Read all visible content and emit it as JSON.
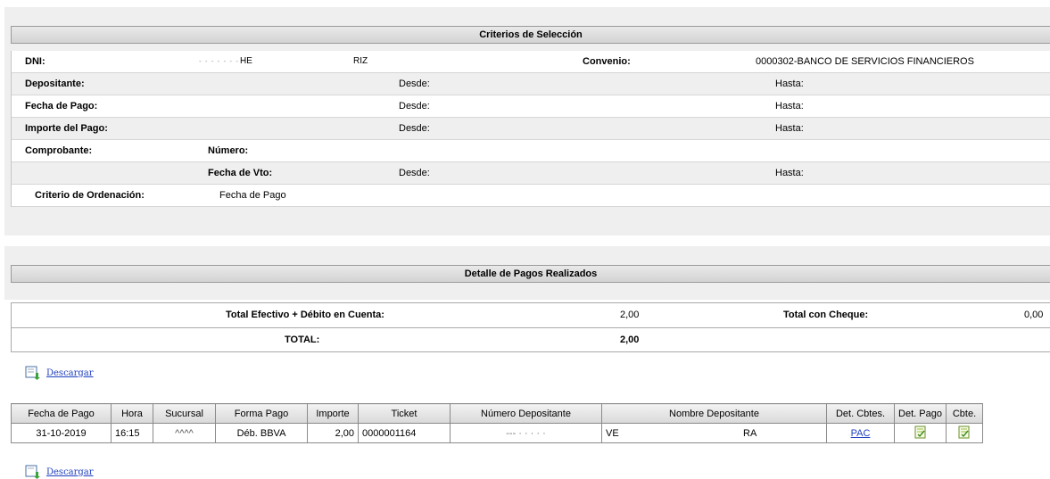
{
  "criteria": {
    "title": "Criterios de Selección",
    "dni_label": "DNI:",
    "dni_mask": "- - - - - - - -",
    "dni_name_a": "HE",
    "dni_name_b": "RIZ",
    "convenio_label": "Convenio:",
    "convenio_value": "0000302-BANCO DE SERVICIOS FINANCIEROS",
    "depositante_label": "Depositante:",
    "fecha_pago_label": "Fecha de Pago:",
    "importe_label": "Importe del Pago:",
    "comprobante_label": "Comprobante:",
    "numero_label": "Número:",
    "fecha_vto_label": "Fecha de Vto:",
    "desde": "Desde:",
    "hasta": "Hasta:",
    "orden_label": "Criterio de Ordenación:",
    "orden_value": "Fecha de Pago"
  },
  "detail": {
    "title": "Detalle de Pagos Realizados",
    "total_efectivo_label": "Total Efectivo + Débito en Cuenta:",
    "total_efectivo_value": "2,00",
    "total_cheque_label": "Total con Cheque:",
    "total_cheque_value": "0,00",
    "total_label": "TOTAL:",
    "total_value": "2,00",
    "download_label": "Descargar"
  },
  "table": {
    "headers": [
      "Fecha de Pago",
      "Hora",
      "Sucursal",
      "Forma Pago",
      "Importe",
      "Ticket",
      "Número Depositante",
      "Nombre Depositante",
      "Det. Cbtes.",
      "Det. Pago",
      "Cbte."
    ],
    "row": {
      "fecha": "31-10-2019",
      "hora": "16:15",
      "sucursal": "^^^^",
      "forma": "Déb. BBVA",
      "importe": "2,00",
      "ticket": "0000001164",
      "numero_dep": "---  · · · · ·",
      "nombre_a": "VE",
      "nombre_b": "RA",
      "det_cbtes": "PAC"
    }
  },
  "icons": {
    "download": "download-doc-icon",
    "doc": "document-check-icon"
  }
}
